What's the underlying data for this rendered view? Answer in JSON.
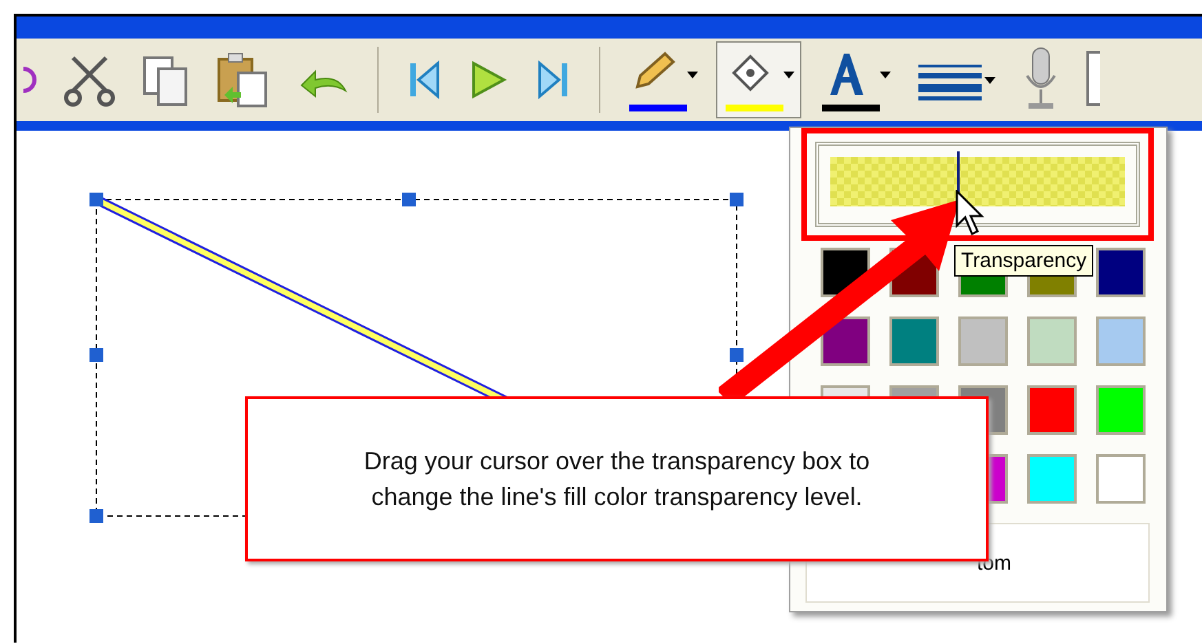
{
  "toolbar": {
    "groups": [
      [
        {
          "kind": "edge-circle",
          "pressed": false
        },
        {
          "kind": "scissors",
          "pressed": false
        },
        {
          "kind": "copy",
          "pressed": false
        },
        {
          "kind": "paste",
          "pressed": false
        },
        {
          "kind": "undo",
          "pressed": false
        }
      ],
      [
        {
          "kind": "skip-back",
          "pressed": false
        },
        {
          "kind": "play",
          "pressed": false
        },
        {
          "kind": "skip-forward",
          "pressed": false
        }
      ],
      [
        {
          "kind": "pencil",
          "pressed": false,
          "color": "#0000ff"
        },
        {
          "kind": "bucket",
          "pressed": true,
          "color": "#ffff00"
        },
        {
          "kind": "font",
          "pressed": false,
          "color": "#000000"
        },
        {
          "kind": "lines",
          "pressed": false
        },
        {
          "kind": "microphone",
          "pressed": false
        },
        {
          "kind": "edge-page",
          "pressed": false
        }
      ]
    ]
  },
  "palette": {
    "transparency": {
      "level": 0.43,
      "tooltip": "Transparency"
    },
    "swatch_rows": [
      [
        {
          "color": "#000000"
        },
        {
          "color": "#800000"
        },
        {
          "color": "#008000"
        },
        {
          "color": "#808000"
        },
        {
          "color": "#000080"
        }
      ],
      [
        {
          "color": "#800080"
        },
        {
          "color": "#008080"
        },
        {
          "color": "#c0c0c0"
        },
        {
          "color": "#c0dcc0"
        },
        {
          "color": "#a6caf0"
        }
      ],
      [
        {
          "color": "#e8e8e8"
        },
        {
          "color": "#a0a0a0"
        },
        {
          "color": "#808080"
        },
        {
          "color": "#ff0000"
        },
        {
          "color": "#00ff00"
        }
      ],
      [
        {
          "color": "#cc00cc"
        },
        {
          "color": "#00ffff"
        },
        {
          "color": "#ffffff"
        }
      ]
    ],
    "custom_button": "tom"
  },
  "callout": {
    "text": "Drag your cursor over the transparency box to change the line's fill color transparency level."
  }
}
